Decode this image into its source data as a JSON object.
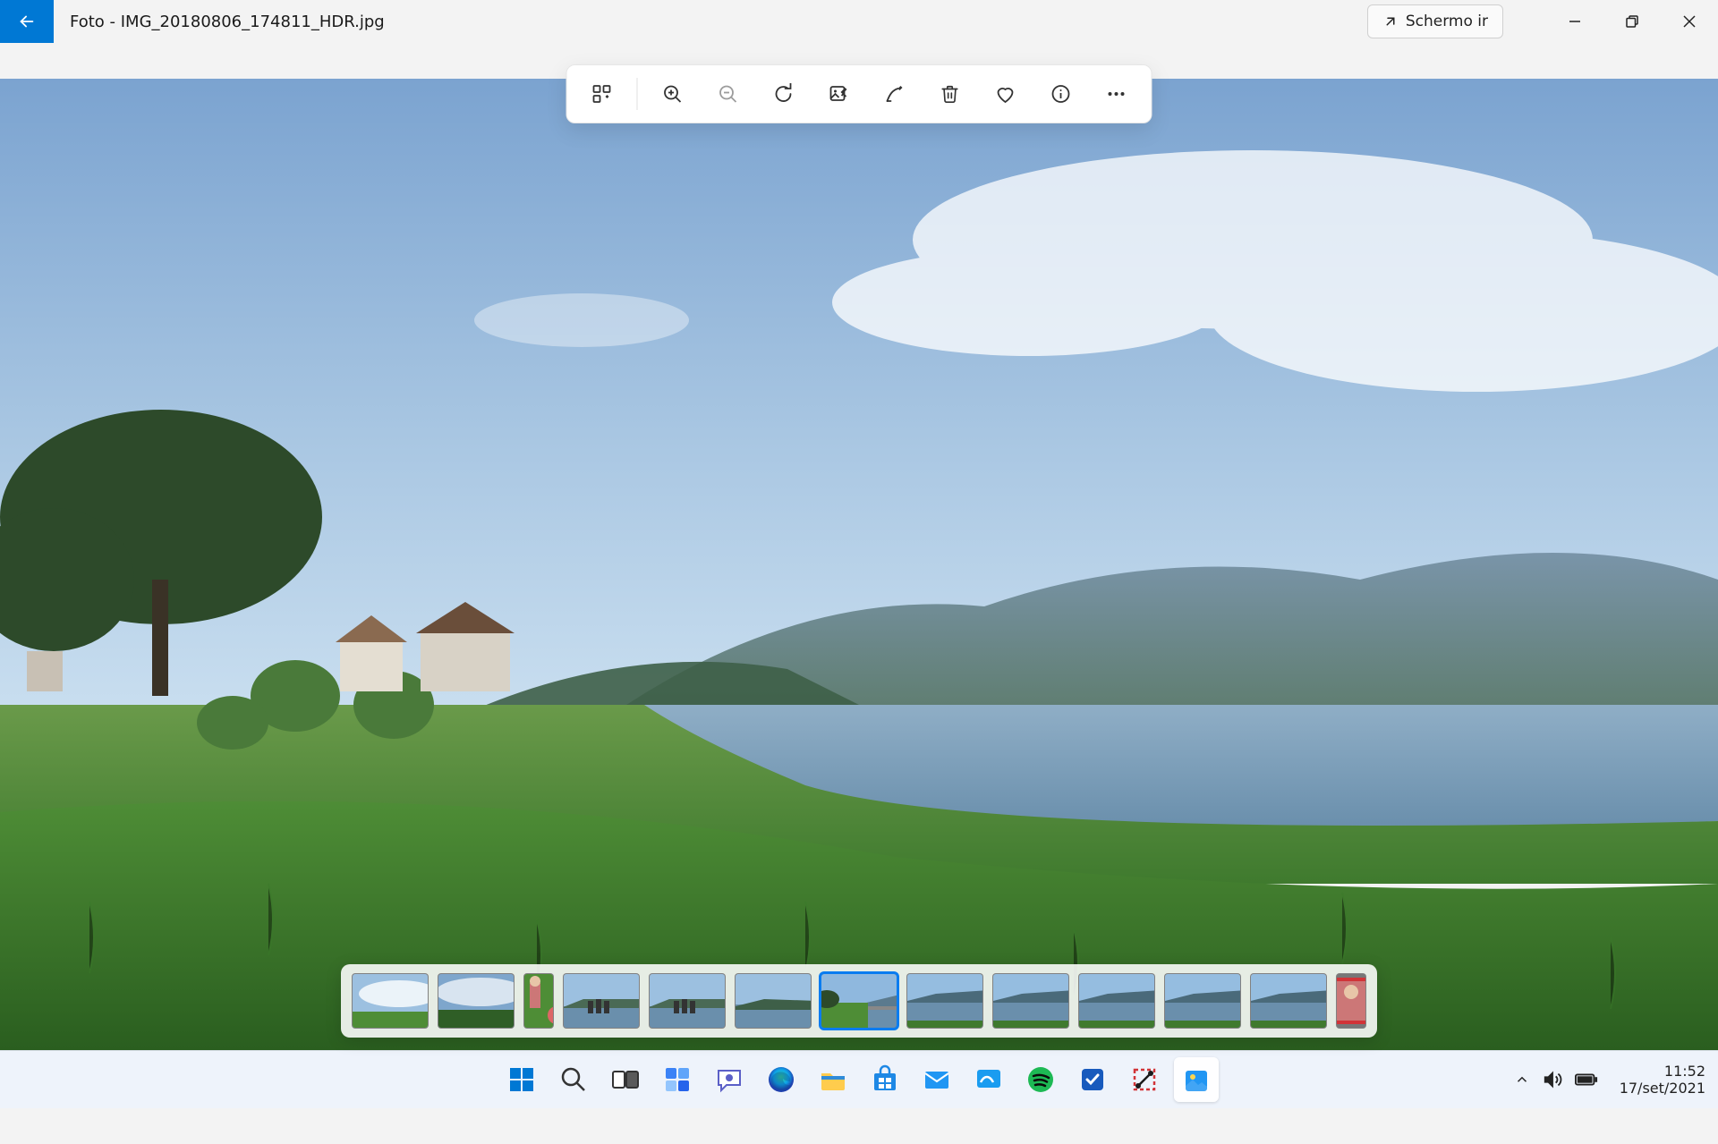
{
  "titlebar": {
    "app_name": "Foto",
    "filename": "IMG_20180806_174811_HDR.jpg",
    "full_title": "Foto - IMG_20180806_174811_HDR.jpg",
    "fullscreen_label": "Schermo ir"
  },
  "toolbar": {
    "collection": "Visualizza tutte le foto",
    "zoom_in": "Zoom in",
    "zoom_out": "Zoom out",
    "rotate": "Ruota",
    "edit": "Modifica immagine",
    "draw": "Disegna",
    "delete": "Elimina",
    "favorite": "Aggiungi a Preferiti",
    "info": "Info",
    "more": "Altro"
  },
  "filmstrip": {
    "selected_index": 6,
    "thumbs": [
      {
        "kind": "sky-grass"
      },
      {
        "kind": "sky-grass-dark"
      },
      {
        "kind": "people-grass",
        "narrow": true
      },
      {
        "kind": "lake-group"
      },
      {
        "kind": "lake-group"
      },
      {
        "kind": "lake-still"
      },
      {
        "kind": "lake-green-selected"
      },
      {
        "kind": "lake-pano"
      },
      {
        "kind": "lake-pano"
      },
      {
        "kind": "lake-pano"
      },
      {
        "kind": "lake-pano"
      },
      {
        "kind": "lake-pano"
      },
      {
        "kind": "portrait",
        "narrow": true
      }
    ]
  },
  "taskbar": {
    "icons": [
      "start",
      "search",
      "taskview",
      "widgets",
      "chat",
      "edge",
      "explorer",
      "store",
      "mail",
      "whiteboard",
      "spotify",
      "todo",
      "snip",
      "photos"
    ]
  },
  "systray": {
    "time": "11:52",
    "date": "17/set/2021"
  }
}
